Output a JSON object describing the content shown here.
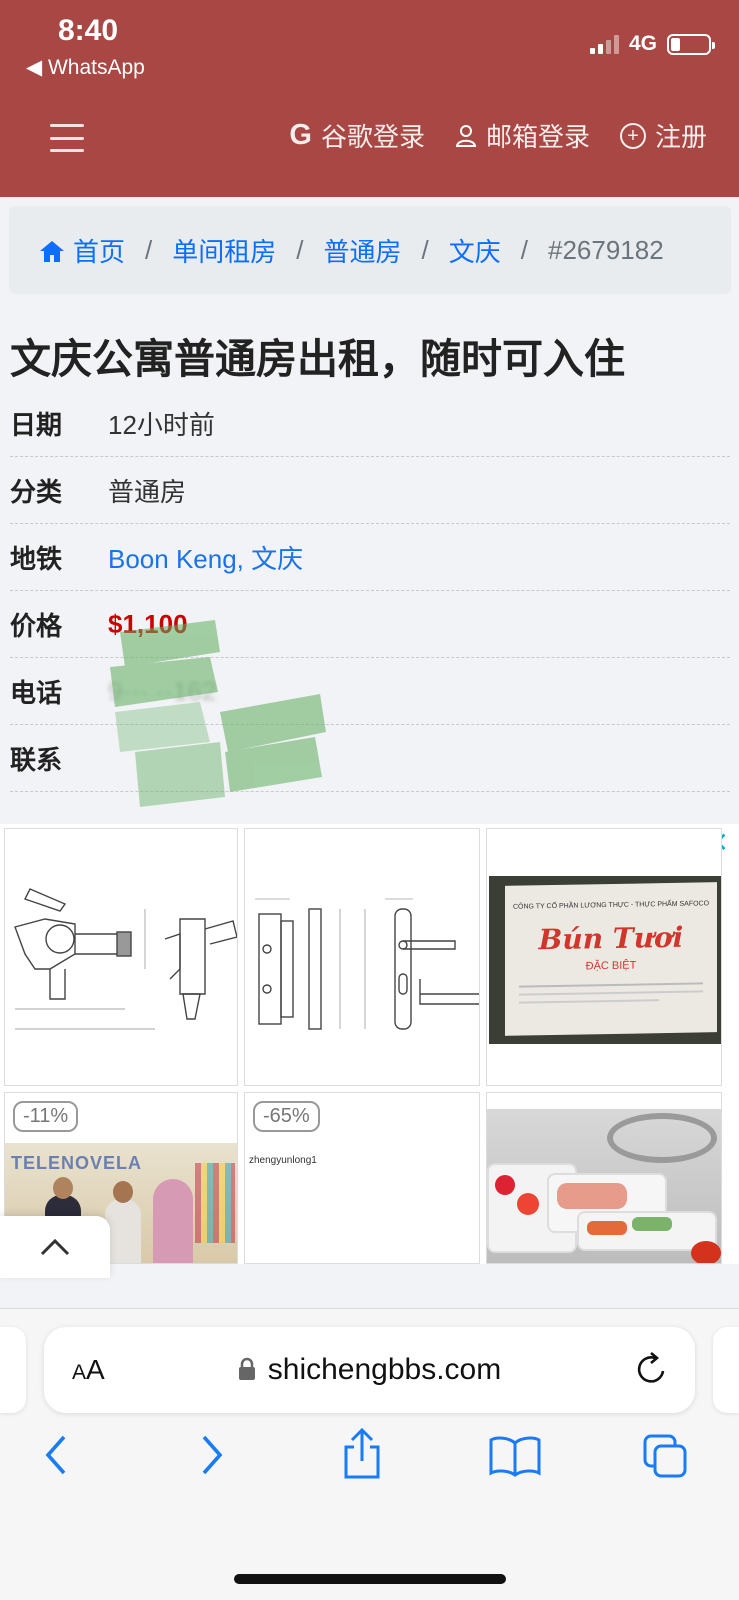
{
  "status_bar": {
    "time": "8:40",
    "back_app": "◀ WhatsApp",
    "network": "4G",
    "battery_level": 0.25
  },
  "nav": {
    "google_login": "谷歌登录",
    "email_login": "邮箱登录",
    "register": "注册"
  },
  "breadcrumb": {
    "items": [
      "首页",
      "单间租房",
      "普通房",
      "文庆"
    ],
    "current": "#2679182"
  },
  "listing": {
    "title": "文庆公寓普通房出租，随时可入住",
    "rows": [
      {
        "key": "日期",
        "value": "12小时前"
      },
      {
        "key": "分类",
        "value": "普通房"
      },
      {
        "key": "地铁",
        "value": "Boon Keng, 文庆"
      },
      {
        "key": "价格",
        "value": "$1,100"
      },
      {
        "key": "电话",
        "value": "9··· ··162"
      },
      {
        "key": "联系",
        "value": ""
      }
    ]
  },
  "ads": {
    "badges": [
      "-11%",
      "-65%"
    ],
    "seller": "zhengyunlong1",
    "box_brand": "Bún Tươi",
    "box_sub": "ĐẶC BIỆT",
    "award_text": "TELENOVELA"
  },
  "safari": {
    "text_size": "AA",
    "url": "shichengbbs.com"
  }
}
